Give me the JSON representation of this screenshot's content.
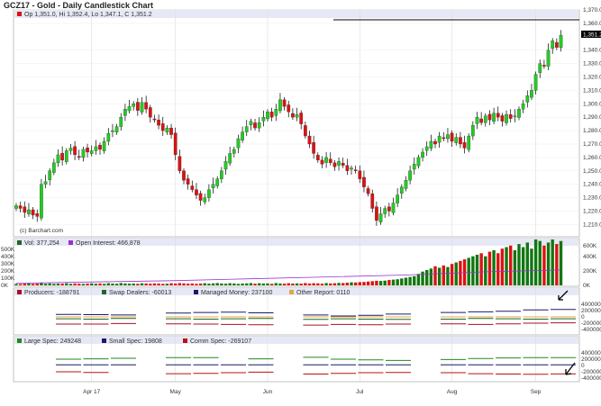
{
  "title": "GCZ17 - Gold - Daily Candlestick Chart",
  "ohlc_label": "Op 1,351.0, Hi 1,352.4, Lo 1,347.1, C 1,351.2",
  "last_price": "1,351.2",
  "watermark": "(c) Barchart.com",
  "vol_label": "Vol: 377,254",
  "oi_label": "Open Interest: 466,878",
  "cot1_legend": [
    "Producers: -188791",
    "Swap Dealers: -60013",
    "Managed Money: 237100",
    "Other Report: 0110"
  ],
  "cot2_legend": [
    "Large Spec: 249248",
    "Small Spec: 19808",
    "Comm Spec: -269107"
  ],
  "colors": {
    "up": "#22cc22",
    "down": "#dd1111",
    "producers": "#aa1122",
    "swap": "#226622",
    "managed": "#1a1a66",
    "other": "#ddaa44",
    "large": "#228822",
    "small": "#1a1a66",
    "comm": "#bb1111",
    "oi": "#9933cc"
  },
  "chart_data": {
    "type": "candlestick",
    "ylim": [
      1205,
      1372
    ],
    "price_ticks": [
      "1,370.0",
      "1,360.0",
      "1,340.0",
      "1,330.0",
      "1,320.0",
      "1,310.0",
      "1,300.0",
      "1,290.0",
      "1,280.0",
      "1,270.0",
      "1,260.0",
      "1,250.0",
      "1,240.0",
      "1,230.0",
      "1,220.0",
      "1,210.0"
    ],
    "price_tick_values": [
      1370,
      1360,
      1340,
      1330,
      1320,
      1310,
      1300,
      1290,
      1280,
      1270,
      1260,
      1250,
      1240,
      1230,
      1220,
      1210
    ],
    "date_labels": [
      "Apr 17",
      "May",
      "Jun",
      "Jul",
      "Aug",
      "Sep"
    ],
    "date_label_index": [
      18,
      38,
      60,
      82,
      104,
      124
    ],
    "closes": [
      1224,
      1222,
      1219,
      1221,
      1217,
      1216,
      1240,
      1242,
      1250,
      1256,
      1262,
      1258,
      1265,
      1267,
      1262,
      1260,
      1266,
      1264,
      1265,
      1268,
      1266,
      1272,
      1278,
      1280,
      1283,
      1290,
      1296,
      1298,
      1300,
      1295,
      1301,
      1296,
      1290,
      1288,
      1284,
      1280,
      1282,
      1277,
      1262,
      1250,
      1243,
      1240,
      1236,
      1232,
      1228,
      1230,
      1236,
      1240,
      1244,
      1250,
      1257,
      1263,
      1266,
      1274,
      1279,
      1283,
      1287,
      1282,
      1286,
      1290,
      1294,
      1290,
      1296,
      1303,
      1298,
      1294,
      1290,
      1292,
      1285,
      1276,
      1270,
      1263,
      1258,
      1255,
      1260,
      1256,
      1253,
      1257,
      1254,
      1250,
      1252,
      1250,
      1244,
      1238,
      1233,
      1222,
      1213,
      1218,
      1222,
      1220,
      1226,
      1232,
      1238,
      1243,
      1250,
      1255,
      1260,
      1264,
      1268,
      1272,
      1270,
      1276,
      1274,
      1277,
      1272,
      1275,
      1270,
      1267,
      1276,
      1284,
      1290,
      1286,
      1291,
      1288,
      1293,
      1290,
      1287,
      1292,
      1289,
      1291,
      1296,
      1300,
      1306,
      1310,
      1322,
      1330,
      1328,
      1340,
      1347,
      1342,
      1351
    ],
    "volume_ticks": [
      "500K",
      "400K",
      "300K",
      "200K",
      "100K",
      "0K"
    ],
    "volume_right_ticks": [
      "600K",
      "400K",
      "200K",
      "0K"
    ],
    "volume_k": [
      20,
      18,
      22,
      25,
      20,
      24,
      30,
      22,
      26,
      20,
      24,
      22,
      28,
      20,
      25,
      22,
      20,
      24,
      26,
      22,
      25,
      20,
      28,
      24,
      22,
      30,
      26,
      22,
      24,
      20,
      28,
      25,
      22,
      26,
      24,
      20,
      22,
      28,
      24,
      30,
      26,
      22,
      25,
      20,
      24,
      28,
      22,
      26,
      30,
      24,
      22,
      28,
      25,
      20,
      24,
      26,
      30,
      22,
      28,
      24,
      26,
      20,
      30,
      25,
      22,
      28,
      24,
      26,
      22,
      30,
      24,
      28,
      26,
      22,
      30,
      25,
      28,
      32,
      30,
      35,
      40,
      38,
      42,
      45,
      50,
      55,
      60,
      58,
      62,
      70,
      75,
      80,
      90,
      100,
      110,
      120,
      150,
      180,
      200,
      220,
      250,
      230,
      260,
      240,
      280,
      300,
      320,
      340,
      360,
      380,
      400,
      420,
      380,
      440,
      460,
      420,
      480,
      500,
      520,
      460,
      540,
      500,
      560,
      480,
      600,
      580,
      520,
      560,
      600,
      540,
      580
    ],
    "open_interest_k": [
      20,
      40,
      60,
      90,
      120,
      150,
      200,
      230
    ],
    "cot1_ticks": [
      "400000",
      "200000",
      "0",
      "-200000",
      "-400000"
    ],
    "cot2_ticks": [
      "400000",
      "200000",
      "0",
      "-200000",
      "-400000"
    ],
    "producers": [
      -230,
      -230,
      -210,
      null,
      -220,
      -230,
      -240,
      -250,
      null,
      -260,
      -240,
      -250,
      -230,
      null,
      -220,
      -240,
      -220,
      -200,
      -190
    ],
    "swap": [
      -60,
      -70,
      -50,
      null,
      -60,
      -70,
      -60,
      -50,
      null,
      -80,
      -60,
      -70,
      -80,
      null,
      -70,
      -50,
      -60,
      -70,
      -60
    ],
    "managed": [
      80,
      70,
      60,
      null,
      120,
      140,
      150,
      130,
      null,
      60,
      30,
      50,
      90,
      null,
      140,
      160,
      180,
      220,
      237
    ],
    "other": [
      0,
      0,
      0,
      null,
      0,
      0,
      0,
      0,
      null,
      0,
      0,
      0,
      0,
      null,
      0,
      0,
      0,
      0,
      0
    ],
    "large": [
      200,
      210,
      230,
      null,
      250,
      250,
      null,
      210,
      null,
      260,
      200,
      180,
      160,
      null,
      190,
      220,
      240,
      250,
      249
    ],
    "small": [
      20,
      20,
      20,
      null,
      20,
      20,
      20,
      20,
      null,
      20,
      20,
      20,
      20,
      null,
      20,
      20,
      20,
      20,
      20
    ],
    "comm": [
      -200,
      -220,
      null,
      null,
      -260,
      -250,
      -230,
      -210,
      null,
      -270,
      -250,
      -230,
      -220,
      null,
      -230,
      -260,
      -270,
      -280,
      -269
    ]
  }
}
